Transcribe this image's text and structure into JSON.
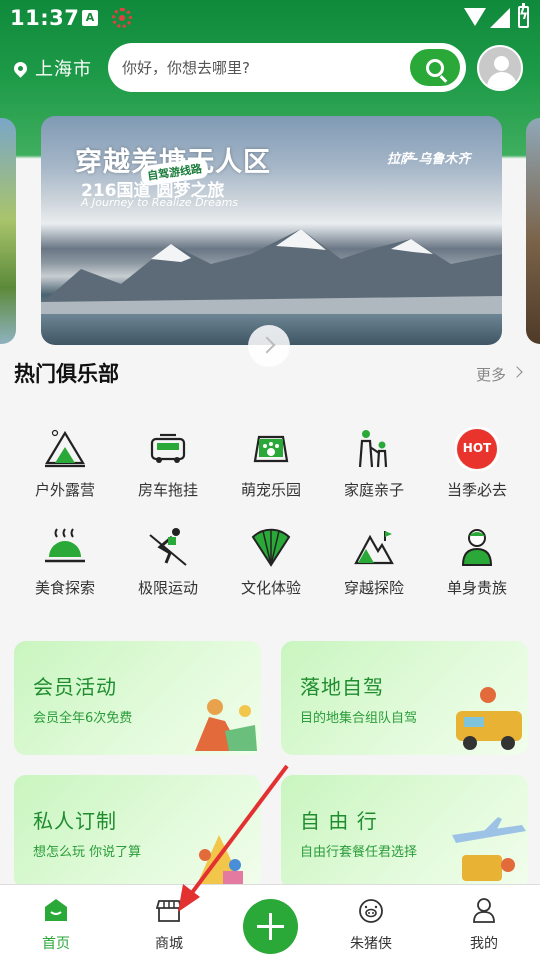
{
  "status_bar": {
    "time": "11:37",
    "a_glyph": "A"
  },
  "header": {
    "location": "上海市",
    "search_placeholder": "你好，你想去哪里?"
  },
  "banner": {
    "title": "穿越羌塘无人区",
    "tag": "自驾游线路",
    "subtitle": "216国道 圆梦之旅",
    "english": "A Journey to Realize Dreams",
    "route": "拉萨-乌鲁木齐"
  },
  "clubs": {
    "title": "热门俱乐部",
    "more": "更多",
    "items": [
      {
        "label": "户外露营",
        "icon": "camping-icon"
      },
      {
        "label": "房车拖挂",
        "icon": "rv-icon"
      },
      {
        "label": "萌宠乐园",
        "icon": "pet-icon"
      },
      {
        "label": "家庭亲子",
        "icon": "family-icon"
      },
      {
        "label": "当季必去",
        "icon": "hot-icon",
        "badge": "HOT"
      },
      {
        "label": "美食探索",
        "icon": "food-icon"
      },
      {
        "label": "极限运动",
        "icon": "ski-icon"
      },
      {
        "label": "文化体验",
        "icon": "fan-icon"
      },
      {
        "label": "穿越探险",
        "icon": "mountain-icon"
      },
      {
        "label": "单身贵族",
        "icon": "single-icon"
      }
    ]
  },
  "cards": [
    {
      "title": "会员活动",
      "subtitle": "会员全年6次免费"
    },
    {
      "title": "落地自驾",
      "subtitle": "目的地集合组队自驾"
    },
    {
      "title": "私人订制",
      "subtitle": "想怎么玩 你说了算"
    },
    {
      "title": "自 由 行",
      "subtitle": "自由行套餐任君选择"
    }
  ],
  "bottom_nav": {
    "home": "首页",
    "shop": "商城",
    "pig": "朱猪侠",
    "mine": "我的"
  },
  "colors": {
    "brand_green": "#2aa838",
    "header_green": "#0f8a3c"
  }
}
